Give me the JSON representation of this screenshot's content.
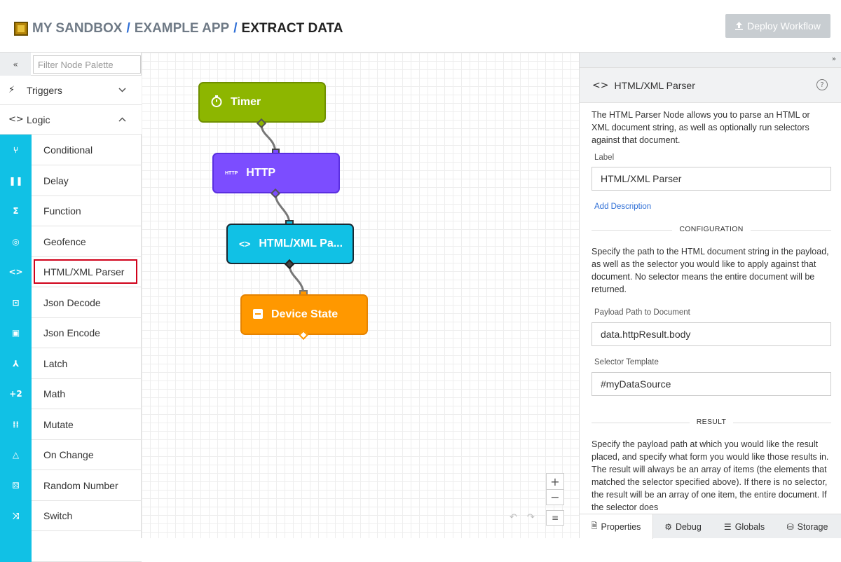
{
  "header": {
    "breadcrumb": [
      "MY SANDBOX",
      "EXAMPLE APP",
      "EXTRACT DATA"
    ],
    "separator": "/",
    "deploy_label": "Deploy Workflow",
    "deploy_icon": "upload-icon"
  },
  "palette": {
    "collapse_icon": "«",
    "filter_placeholder": "Filter Node Palette",
    "categories": [
      {
        "icon": "⚡",
        "label": "Triggers",
        "chevron": "⌄"
      },
      {
        "icon": "<>",
        "label": "Logic",
        "chevron": "⌃"
      }
    ],
    "items": [
      {
        "icon": "⑂",
        "label": "Conditional"
      },
      {
        "icon": "❚❚",
        "label": "Delay"
      },
      {
        "icon": "Σ",
        "label": "Function"
      },
      {
        "icon": "◎",
        "label": "Geofence"
      },
      {
        "icon": "<>",
        "label": "HTML/XML Parser"
      },
      {
        "icon": "⊡",
        "label": "Json Decode"
      },
      {
        "icon": "▣",
        "label": "Json Encode"
      },
      {
        "icon": "⅄",
        "label": "Latch"
      },
      {
        "icon": "+2",
        "label": "Math"
      },
      {
        "icon": "⁞⁞",
        "label": "Mutate"
      },
      {
        "icon": "△",
        "label": "On Change"
      },
      {
        "icon": "⚄",
        "label": "Random Number"
      },
      {
        "icon": "⤨",
        "label": "Switch"
      }
    ],
    "selected_item": "HTML/XML Parser"
  },
  "canvas": {
    "nodes": [
      {
        "label": "Timer",
        "icon": "⏱",
        "color": "#8db600"
      },
      {
        "label": "HTTP",
        "icon": "HTTP",
        "color": "#7c4dff"
      },
      {
        "label": "HTML/XML Pa...",
        "icon": "<>",
        "color": "#11c1e5"
      },
      {
        "label": "Device State",
        "icon": "▬",
        "color": "#ff9800"
      }
    ],
    "zoom_in": "+",
    "zoom_out": "−",
    "list_icon": "≡",
    "undo_icon": "↶",
    "redo_icon": "↷"
  },
  "panel": {
    "expand_icon": "»",
    "title_icon": "<>",
    "title": "HTML/XML Parser",
    "help_icon": "?",
    "intro": "The HTML Parser Node allows you to parse an HTML or XML document string, as well as optionally run selectors against that document.",
    "label_caption": "Label",
    "label_value": "HTML/XML Parser",
    "add_description": "Add Description",
    "config_heading": "CONFIGURATION",
    "config_text": "Specify the path to the HTML document string in the payload, as well as the selector you would like to apply against that document. No selector means the entire document will be returned.",
    "payload_caption": "Payload Path to Document",
    "payload_value": "data.httpResult.body",
    "selector_caption": "Selector Template",
    "selector_value": "#myDataSource",
    "result_heading": "RESULT",
    "result_text": "Specify the payload path at which you would like the result placed, and specify what form you would like those results in. The result will always be an array of items (the elements that matched the selector specified above). If there is no selector, the result will be an array of one item, the entire document. If the selector does",
    "tabs": [
      {
        "icon": "🗎",
        "label": "Properties"
      },
      {
        "icon": "⚙",
        "label": "Debug"
      },
      {
        "icon": "☰",
        "label": "Globals"
      },
      {
        "icon": "⛁",
        "label": "Storage"
      }
    ]
  }
}
